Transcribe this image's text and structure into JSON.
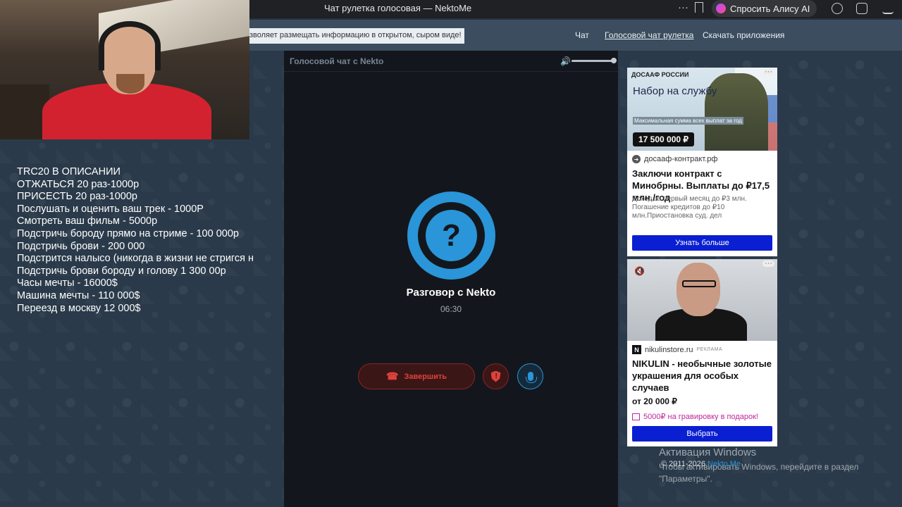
{
  "browser": {
    "tab_title": "Чат рулетка голосовая — NektoMe",
    "menu_glyph": "···",
    "alice_button": "Спросить Алису AI"
  },
  "site": {
    "info_note": "зволяет размещать информацию в открытом, сыром виде!",
    "nav": [
      "Чат",
      "Голосовой чат рулетка",
      "Скачать приложения"
    ]
  },
  "overlay": {
    "lines": [
      "TRC20 В ОПИСАНИИ",
      "ОТЖАТЬСЯ 20 раз-1000р",
      "ПРИСЕСТЬ 20 раз-1000р",
      "Послушать и оценить ваш трек - 1000Р",
      "Смотреть ваш фильм - 5000р",
      "Подстричь бороду прямо на стриме - 100 000р",
      "Подстричь брови - 200 000",
      "Подстрится налысо (никогда в жизни не стригся н",
      "Подстричь брови бороду и голову 1 300 00р",
      "Часы мечты - 16000$",
      "Машина мечты - 110 000$",
      "Переезд в москву 12 000$"
    ]
  },
  "chat": {
    "panel_title": "Голосовой чат с Nekto",
    "volume_icon": "🔊",
    "avatar_glyph": "?",
    "call_title": "Разговор с Nekto",
    "timer": "06:30",
    "end_label": "Завершить",
    "phone_glyph": "☎",
    "report_glyph": "!"
  },
  "ads": {
    "ad1": {
      "brand": "ДОСААФ РОССИИ",
      "headline": "Набор на службу",
      "small_text": "Максимальная сумма всех выплат за год",
      "price_tag": "17 500 000 ₽",
      "dots": "···",
      "domain": "досааф-контракт.рф",
      "arrow_glyph": "➜",
      "title": "Заключи контракт с Минобрны. Выплаты до ₽17,5 млн./год",
      "desc": "Доход за первый месяц до ₽3 млн. Погашение кредитов до ₽10 млн.Приостановка суд. дел",
      "cta": "Узнать больше"
    },
    "ad2": {
      "mute_glyph": "🔇",
      "dots": "···",
      "n_glyph": "N",
      "domain": "nikulinstore.ru",
      "label": "РЕКЛАМА",
      "title": "NIKULIN - необычные золотые украшения для особых случаев",
      "price": "от 20 000 ₽",
      "promo": "5000₽ на гравировку в подарок!",
      "cta": "Выбрать"
    }
  },
  "footer": {
    "copyright_prefix": "© 2011-2026 ",
    "copyright_link": "Nekto.Me"
  },
  "windows": {
    "activate_title": "Активация Windows",
    "activate_text": "Чтобы активировать Windows, перейдите в раздел \"Параметры\"."
  },
  "colors": {
    "accent_blue": "#2a95d8",
    "end_red": "#e0413b",
    "ad_cta": "#0a1fd1"
  }
}
